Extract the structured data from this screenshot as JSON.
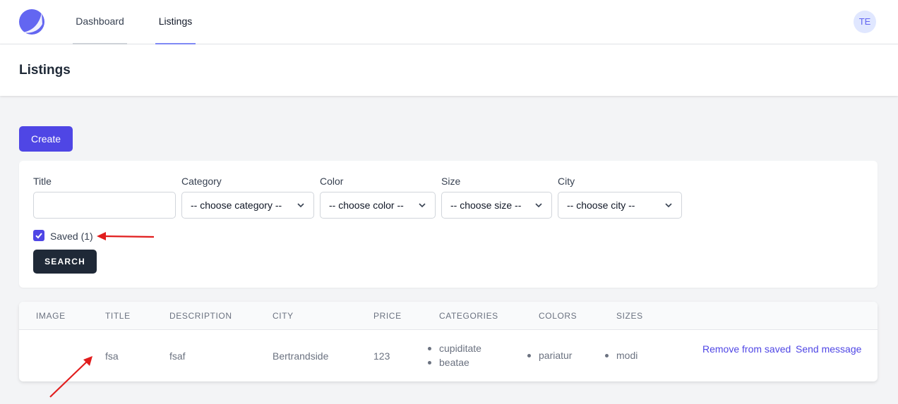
{
  "nav": {
    "tabs": [
      {
        "label": "Dashboard"
      },
      {
        "label": "Listings"
      }
    ],
    "avatar_initials": "TE"
  },
  "page": {
    "title": "Listings"
  },
  "create_label": "Create",
  "filters": {
    "title_label": "Title",
    "title_value": "",
    "category_label": "Category",
    "category_value": "-- choose category --",
    "color_label": "Color",
    "color_value": "-- choose color --",
    "size_label": "Size",
    "size_value": "-- choose size --",
    "city_label": "City",
    "city_value": "-- choose city --",
    "saved_label": "Saved (1)",
    "saved_checked": true,
    "search_label": "SEARCH"
  },
  "table": {
    "headers": [
      "IMAGE",
      "TITLE",
      "DESCRIPTION",
      "CITY",
      "PRICE",
      "CATEGORIES",
      "COLORS",
      "SIZES"
    ],
    "rows": [
      {
        "title": "fsa",
        "description": "fsaf",
        "city": "Bertrandside",
        "price": "123",
        "categories": [
          "cupiditate",
          "beatae"
        ],
        "colors": [
          "pariatur"
        ],
        "sizes": [
          "modi"
        ],
        "actions": [
          "Remove from saved",
          "Send message"
        ]
      }
    ]
  },
  "colors": {
    "accent": "#4f46e5",
    "dark_button": "#1f2937",
    "annotation_arrow": "#e11d1d"
  }
}
